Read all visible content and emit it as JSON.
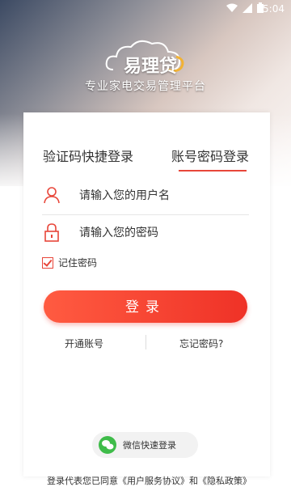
{
  "status_bar": {
    "time": "5:04"
  },
  "brand": {
    "logo_text": "易理贷",
    "tagline": "专业家电交易管理平台"
  },
  "tabs": {
    "sms_login": "验证码快捷登录",
    "account_login": "账号密码登录"
  },
  "form": {
    "username_placeholder": "请输入您的用户名",
    "password_placeholder": "请输入您的密码",
    "remember_label": "记住密码",
    "remember_checked": true
  },
  "buttons": {
    "login": "登录"
  },
  "links": {
    "open_account": "开通账号",
    "forgot_password": "忘记密码?"
  },
  "wechat": {
    "label": "微信快速登录"
  },
  "agreement": {
    "text": "登录代表您已同意《用户服务协议》和《隐私政策》"
  },
  "colors": {
    "accent": "#e8463a",
    "wechat": "#3fbc4a"
  }
}
